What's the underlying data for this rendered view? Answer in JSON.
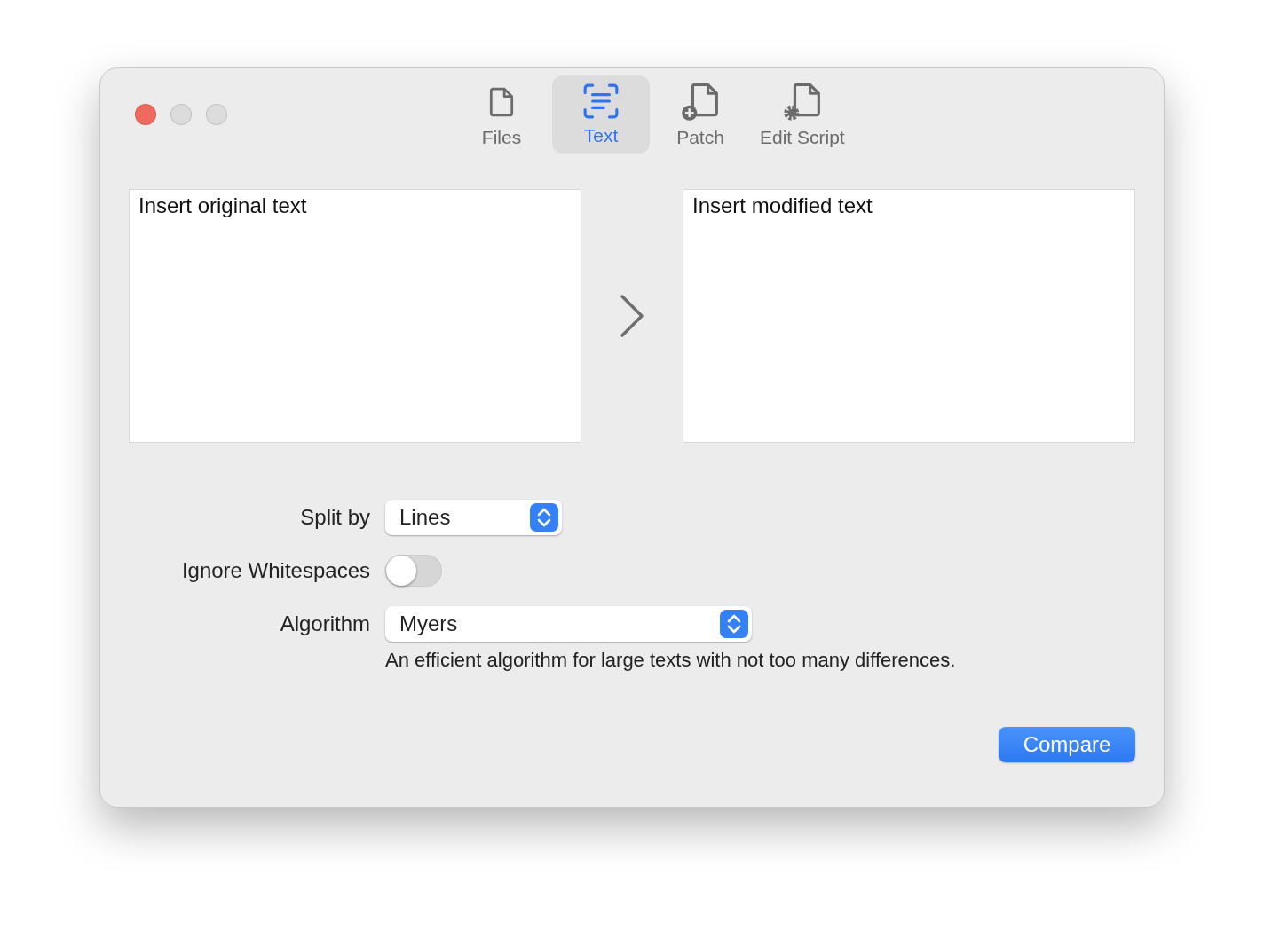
{
  "window": {
    "controls": [
      {
        "kind": "close"
      },
      {
        "kind": "minimize"
      },
      {
        "kind": "zoom"
      }
    ]
  },
  "tabs": [
    {
      "label": "Files",
      "kind": "file",
      "selected": false
    },
    {
      "label": "Text",
      "kind": "text",
      "selected": true
    },
    {
      "label": "Patch",
      "kind": "patch",
      "selected": false
    },
    {
      "label": "Edit Script",
      "kind": "script",
      "selected": false
    }
  ],
  "editors": [
    {
      "value": "Insert original text"
    },
    {
      "value": "Insert modified text"
    }
  ],
  "options": [
    {
      "kind": "select",
      "label": "Split by",
      "value": "Lines"
    },
    {
      "kind": "toggle",
      "label": "Ignore Whitespaces",
      "on": false
    },
    {
      "kind": "select",
      "label": "Algorithm",
      "value": "Myers"
    }
  ],
  "description": "An efficient algorithm for large texts with not too many differences.",
  "compare_button": "Compare"
}
